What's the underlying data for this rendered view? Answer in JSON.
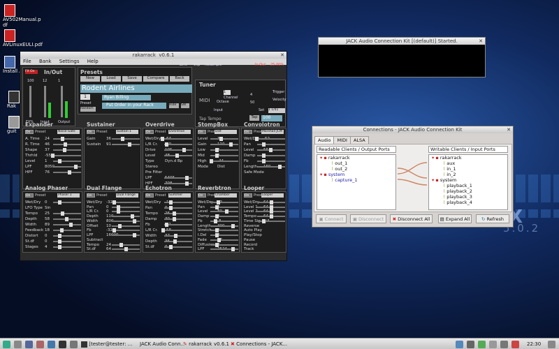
{
  "desktop": {
    "icons": [
      {
        "label": "AV502Manual.p df"
      },
      {
        "label": "AVLinuxEULI.pdf"
      },
      {
        "label": "Install A"
      },
      {
        "label": "Rak"
      },
      {
        "label": "guit"
      }
    ],
    "logo_text": "X",
    "logo_version": "5.0.2"
  },
  "rakarrack": {
    "title": "rakarrack",
    "version": "v0.6.1",
    "menu": [
      "File",
      "Bank",
      "Settings",
      "Help"
    ],
    "inout": {
      "title": "In/Out",
      "in_label": "In",
      "out_label": "Out",
      "left_value": "100",
      "mid_value": "12",
      "right_value": "1",
      "fx_pct": "FX%",
      "input": "Input",
      "output": "Output"
    },
    "top_right": {
      "limit": "Limt",
      "clip": "Clip",
      "resample": "Resample",
      "in_out": "In Out",
      "cpu": "25.00%"
    },
    "presets": {
      "title": "Presets",
      "buttons": [
        "New",
        "Load",
        "Save",
        "Compare",
        "Back"
      ],
      "bank": "1",
      "preset_label": "Preset",
      "random": "Random",
      "name": "Rodent Airlines",
      "author": "Ryan Billing",
      "message": "Put Order in your Rack",
      "hide": "Hide",
      "sw": "SW"
    },
    "tuner": {
      "title": "Tuner",
      "midi": "MIDI",
      "channel_value": "1",
      "channel": "Channel",
      "octave": "Octave",
      "trigger": "Trigger",
      "velocity": "Velocity",
      "v1": "4",
      "v2": "50",
      "tap_tempo": "Tap Tempo",
      "input": "Input",
      "tap": "Tap",
      "tap_value": "100",
      "set": "Set",
      "ratio": "1 1/41"
    },
    "effects": [
      {
        "name": "Expander",
        "preset": "Noise Gate",
        "rows": [
          [
            "A. Time",
            "24"
          ],
          [
            "R. Time",
            "46"
          ],
          [
            "Shape",
            "37"
          ],
          [
            "Thrhld",
            "-55"
          ],
          [
            "Level",
            "1"
          ],
          [
            "LPF",
            "8050"
          ],
          [
            "HPF",
            "76"
          ]
        ]
      },
      {
        "name": "Sustainer",
        "preset": "Sustain 1",
        "rows": [
          [
            "Gain",
            "36"
          ],
          [
            "Sustain",
            "91"
          ]
        ]
      },
      {
        "name": "Overdrive",
        "preset": "Overdrive",
        "rows": [
          [
            "Wet/Dry",
            "-64"
          ],
          [
            "L/R Cr.",
            "-29"
          ],
          [
            "Drive",
            "105"
          ],
          [
            "Level",
            "48"
          ],
          [
            "Type",
            "Dyn.d Bp"
          ],
          [
            "Stereo",
            ""
          ],
          [
            "Pre Filter",
            ""
          ],
          [
            "LPF",
            "5406"
          ],
          [
            "HPF",
            "708"
          ]
        ]
      },
      {
        "name": "StompBox",
        "preset": "Dist",
        "rows": [
          [
            "Level",
            "32"
          ],
          [
            "Gain",
            "110"
          ],
          [
            "Low",
            "0"
          ],
          [
            "Mid",
            "0"
          ],
          [
            "High",
            "-44"
          ],
          [
            "Mode",
            "Dist"
          ]
        ]
      },
      {
        "name": "Convolotron",
        "preset": "Marshall JCM",
        "rows": [
          [
            "Wet/Dry",
            "-52"
          ],
          [
            "Pan",
            "0"
          ],
          [
            "Level",
            "56"
          ],
          [
            "Damp",
            "0"
          ],
          [
            "Fb",
            "0"
          ],
          [
            "Length",
            "160"
          ],
          [
            "Safe Mode",
            ""
          ]
        ]
      },
      {
        "name": "Analog Phaser",
        "preset": "Phaser 1",
        "rows": [
          [
            "Wet/Dry",
            "0"
          ],
          [
            "LFO Type",
            "Sin"
          ],
          [
            "Tempo",
            "25"
          ],
          [
            "Depth",
            "58"
          ],
          [
            "Width",
            "89"
          ],
          [
            "Feedback",
            "18"
          ],
          [
            "Distort",
            "0"
          ],
          [
            "St.df",
            "0"
          ],
          [
            "Stages",
            "4"
          ]
        ]
      },
      {
        "name": "Dual Flange",
        "preset": "Dual Flange",
        "rows": [
          [
            "Wet/Dry",
            "-32"
          ],
          [
            "Pan",
            "0"
          ],
          [
            "L/R Cr.",
            "0"
          ],
          [
            "Depth",
            "110"
          ],
          [
            "Width",
            "800"
          ],
          [
            "Offset",
            "10"
          ],
          [
            "Fb",
            "-32"
          ],
          [
            "LPF",
            "16000"
          ],
          [
            "Subtract",
            ""
          ],
          [
            "Tempo",
            "24"
          ],
          [
            "St.df",
            "64"
          ]
        ]
      },
      {
        "name": "Echotron",
        "preset": "Summer",
        "rows": [
          [
            "Wet/Dry",
            "-1"
          ],
          [
            "Pan",
            "0"
          ],
          [
            "Tempo",
            "26"
          ],
          [
            "Damp",
            "30"
          ],
          [
            "Fb",
            "-31"
          ],
          [
            "L/R Cr.",
            "-58"
          ],
          [
            "Width",
            "37"
          ],
          [
            "Depth",
            "36"
          ],
          [
            "St.df",
            "0"
          ]
        ]
      },
      {
        "name": "Reverbtron",
        "preset": "Chamber",
        "rows": [
          [
            "Wet/Dry",
            "12"
          ],
          [
            "Pan",
            "0"
          ],
          [
            "Level",
            "80"
          ],
          [
            "Damp",
            "0"
          ],
          [
            "Fb",
            "-8"
          ],
          [
            "Length",
            "400"
          ],
          [
            "Stretch",
            "0"
          ],
          [
            "I.Del",
            "0"
          ],
          [
            "Fade",
            "17"
          ],
          [
            "Diffusion",
            "0"
          ],
          [
            "LPF",
            "2524"
          ]
        ]
      },
      {
        "name": "Looper",
        "preset": "Looper",
        "rows": [
          [
            "Wet/Dry",
            "64"
          ],
          [
            "Level 1",
            "64"
          ],
          [
            "Level 2",
            "64"
          ],
          [
            "Tempo",
            "64"
          ],
          [
            "Time Sig",
            "4/4"
          ],
          [
            "Reverse",
            ""
          ],
          [
            "Auto Play",
            ""
          ],
          [
            "Play/Stop",
            ""
          ],
          [
            "Pause",
            ""
          ],
          [
            "Record",
            ""
          ],
          [
            "Track",
            ""
          ]
        ]
      }
    ]
  },
  "jack": {
    "title": "JACK Audio Connection Kit [(default)] Started."
  },
  "connections": {
    "title": "Connections - JACK Audio Connection Kit",
    "tabs": [
      "Audio",
      "MIDI",
      "ALSA"
    ],
    "readable_label": "Readable Clients / Output Ports",
    "writable_label": "Writable Clients / Input Ports",
    "readable": [
      {
        "text": "rakarrack",
        "level": 0
      },
      {
        "text": "out_1",
        "level": 2
      },
      {
        "text": "out_2",
        "level": 2
      },
      {
        "text": "system",
        "level": 0
      },
      {
        "text": "capture_1",
        "level": 2
      }
    ],
    "writable": [
      {
        "text": "rakarrack",
        "level": 0
      },
      {
        "text": "aux",
        "level": 2
      },
      {
        "text": "in_1",
        "level": 2
      },
      {
        "text": "in_2",
        "level": 2
      },
      {
        "text": "system",
        "level": 0
      },
      {
        "text": "playback_1",
        "level": 2
      },
      {
        "text": "playback_2",
        "level": 2
      },
      {
        "text": "playback_3",
        "level": 2
      },
      {
        "text": "playback_4",
        "level": 2
      }
    ],
    "buttons": {
      "connect": "Connect",
      "disconnect": "Disconnect",
      "disconnect_all": "Disconnect All",
      "expand_all": "Expand All",
      "refresh": "Refresh"
    }
  },
  "taskbar": {
    "items": [
      {
        "label": "[tester@tester: ..."
      },
      {
        "label": "JACK Audio Conn..."
      },
      {
        "label": "rakarrack"
      },
      {
        "label": "v0.6.1"
      },
      {
        "label": "Connections - JACK..."
      }
    ],
    "clock": "22:30"
  }
}
